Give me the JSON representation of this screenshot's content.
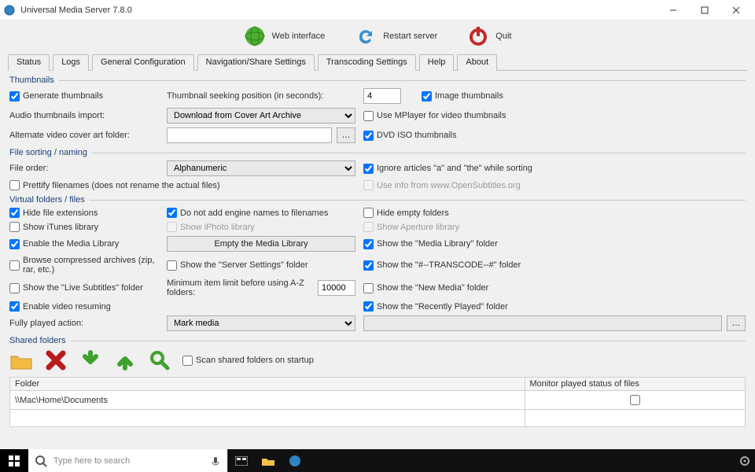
{
  "window": {
    "title": "Universal Media Server 7.8.0"
  },
  "toolbar": {
    "web": "Web interface",
    "restart": "Restart server",
    "quit": "Quit"
  },
  "tabs": [
    "Status",
    "Logs",
    "General Configuration",
    "Navigation/Share Settings",
    "Transcoding Settings",
    "Help",
    "About"
  ],
  "section": {
    "thumbnails_title": "Thumbnails",
    "filesort_title": "File sorting / naming",
    "virtual_title": "Virtual folders / files",
    "shared_title": "Shared folders"
  },
  "thumbnails": {
    "generate": "Generate thumbnails",
    "seek_label": "Thumbnail seeking position (in seconds):",
    "seek_value": "4",
    "image_thumbs": "Image thumbnails",
    "audio_label": "Audio thumbnails import:",
    "audio_select": "Download from Cover Art Archive",
    "use_mplayer": "Use MPlayer for video thumbnails",
    "alt_cover_label": "Alternate video cover art folder:",
    "dvd_iso": "DVD ISO thumbnails"
  },
  "filesort": {
    "order_label": "File order:",
    "order_value": "Alphanumeric",
    "ignore_articles": "Ignore articles \"a\" and \"the\" while sorting",
    "prettify": "Prettify filenames (does not rename the actual files)",
    "opensubs": "Use info from www.OpenSubtitles.org"
  },
  "virtual": {
    "hide_ext": "Hide file extensions",
    "no_engine": "Do not add engine names to filenames",
    "hide_empty": "Hide empty folders",
    "itunes": "Show iTunes library",
    "iphoto": "Show iPhoto library",
    "aperture": "Show Aperture library",
    "enable_media": "Enable the Media Library",
    "empty_media_btn": "Empty the Media Library",
    "show_media": "Show the \"Media Library\" folder",
    "browse_zip": "Browse compressed archives (zip, rar, etc.)",
    "show_server_settings": "Show the \"Server Settings\" folder",
    "show_transcode": "Show the \"#--TRANSCODE--#\" folder",
    "live_subs": "Show the \"Live Subtitles\" folder",
    "min_limit_label": "Minimum item limit before using A-Z folders:",
    "min_limit_value": "10000",
    "show_new_media": "Show the \"New Media\" folder",
    "enable_resume": "Enable video resuming",
    "show_recent": "Show the \"Recently Played\" folder",
    "fully_played_label": "Fully played action:",
    "fully_played_value": "Mark media"
  },
  "shared": {
    "scan_startup": "Scan shared folders on startup",
    "col_folder": "Folder",
    "col_monitor": "Monitor played status of files",
    "row0_folder": "\\\\Mac\\Home\\Documents"
  },
  "taskbar": {
    "search_placeholder": "Type here to search"
  }
}
